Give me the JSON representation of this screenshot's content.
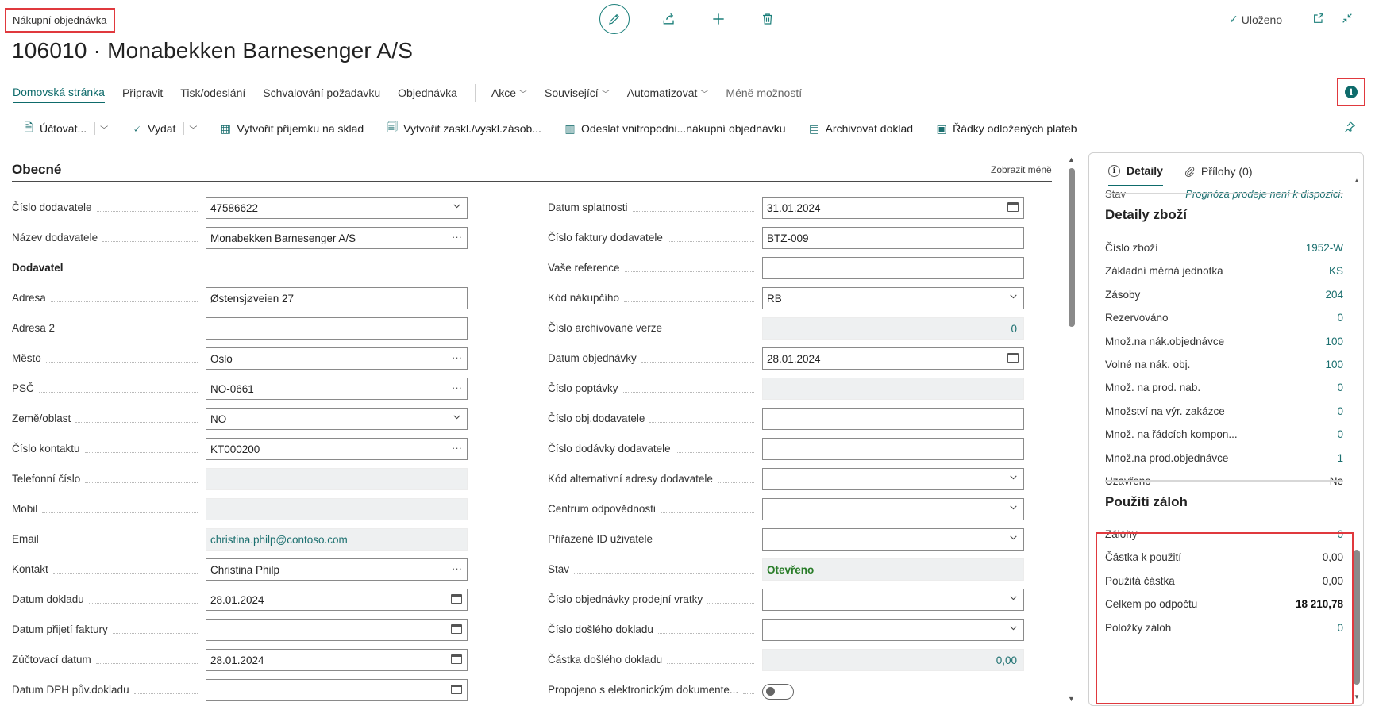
{
  "header": {
    "page_type": "Nákupní objednávka",
    "title": "106010 · Monabekken Barnesenger A/S",
    "saved_label": "Uloženo"
  },
  "nav": {
    "tabs": [
      {
        "label": "Domovská stránka"
      },
      {
        "label": "Připravit"
      },
      {
        "label": "Tisk/odeslání"
      },
      {
        "label": "Schvalování požadavku"
      },
      {
        "label": "Objednávka"
      }
    ],
    "menus": [
      {
        "label": "Akce"
      },
      {
        "label": "Související"
      },
      {
        "label": "Automatizovat"
      }
    ],
    "fewer_options": "Méně možností"
  },
  "actions": [
    {
      "label": "Účtovat...",
      "icon": "post-icon"
    },
    {
      "label": "Vydat",
      "icon": "release-icon"
    },
    {
      "label": "Vytvořit příjemku na sklad",
      "icon": "warehouse-receipt-icon"
    },
    {
      "label": "Vytvořit zaskl./vyskl.zásob...",
      "icon": "inventory-icon"
    },
    {
      "label": "Odeslat vnitropodni...nákupní objednávku",
      "icon": "intercompany-icon"
    },
    {
      "label": "Archivovat doklad",
      "icon": "archive-icon"
    },
    {
      "label": "Řádky odložených plateb",
      "icon": "deferral-icon"
    }
  ],
  "general": {
    "section_title": "Obecné",
    "show_less": "Zobrazit méně",
    "left": [
      {
        "label": "Číslo dodavatele",
        "value": "47586622",
        "kind": "dropdown"
      },
      {
        "label": "Název dodavatele",
        "value": "Monabekken Barnesenger A/S",
        "kind": "lookup"
      },
      {
        "label": "Dodavatel",
        "value": "",
        "kind": "heading"
      },
      {
        "label": "Adresa",
        "value": "Østensjøveien 27",
        "kind": "text"
      },
      {
        "label": "Adresa 2",
        "value": "",
        "kind": "text"
      },
      {
        "label": "Město",
        "value": "Oslo",
        "kind": "lookup"
      },
      {
        "label": "PSČ",
        "value": "NO-0661",
        "kind": "lookup"
      },
      {
        "label": "Země/oblast",
        "value": "NO",
        "kind": "dropdown"
      },
      {
        "label": "Číslo kontaktu",
        "value": "KT000200",
        "kind": "lookup"
      },
      {
        "label": "Telefonní číslo",
        "value": "",
        "kind": "readonly"
      },
      {
        "label": "Mobil",
        "value": "",
        "kind": "readonly"
      },
      {
        "label": "Email",
        "value": "christina.philp@contoso.com",
        "kind": "readonly-link"
      },
      {
        "label": "Kontakt",
        "value": "Christina Philp",
        "kind": "lookup"
      },
      {
        "label": "Datum dokladu",
        "value": "28.01.2024",
        "kind": "date"
      },
      {
        "label": "Datum přijetí faktury",
        "value": "",
        "kind": "date"
      },
      {
        "label": "Zúčtovací datum",
        "value": "28.01.2024",
        "kind": "date"
      },
      {
        "label": "Datum DPH pův.dokladu",
        "value": "",
        "kind": "date"
      }
    ],
    "right": [
      {
        "label": "Datum splatnosti",
        "value": "31.01.2024",
        "kind": "date"
      },
      {
        "label": "Číslo faktury dodavatele",
        "value": "BTZ-009",
        "kind": "text"
      },
      {
        "label": "Vaše reference",
        "value": "",
        "kind": "text"
      },
      {
        "label": "Kód nákupčího",
        "value": "RB",
        "kind": "dropdown"
      },
      {
        "label": "Číslo archivované verze",
        "value": "0",
        "kind": "readonly-num"
      },
      {
        "label": "Datum objednávky",
        "value": "28.01.2024",
        "kind": "date"
      },
      {
        "label": "Číslo poptávky",
        "value": "",
        "kind": "readonly"
      },
      {
        "label": "Číslo obj.dodavatele",
        "value": "",
        "kind": "text"
      },
      {
        "label": "Číslo dodávky dodavatele",
        "value": "",
        "kind": "text"
      },
      {
        "label": "Kód alternativní adresy dodavatele",
        "value": "",
        "kind": "dropdown"
      },
      {
        "label": "Centrum odpovědnosti",
        "value": "",
        "kind": "dropdown"
      },
      {
        "label": "Přiřazené ID uživatele",
        "value": "",
        "kind": "dropdown"
      },
      {
        "label": "Stav",
        "value": "Otevřeno",
        "kind": "status"
      },
      {
        "label": "Číslo objednávky prodejní vratky",
        "value": "",
        "kind": "dropdown"
      },
      {
        "label": "Číslo došlého dokladu",
        "value": "",
        "kind": "dropdown"
      },
      {
        "label": "Částka došlého dokladu",
        "value": "0,00",
        "kind": "readonly-num"
      },
      {
        "label": "Propojeno s elektronickým dokumente...",
        "value": "",
        "kind": "toggle"
      }
    ]
  },
  "factbox": {
    "tabs": [
      {
        "label": "Detaily"
      },
      {
        "label": "Přílohy (0)"
      }
    ],
    "cut_row": {
      "label": "Stav",
      "value": "Prognóza prodeje není k dispozici."
    },
    "item_details": {
      "title": "Detaily zboží",
      "rows": [
        {
          "label": "Číslo zboží",
          "value": "1952-W"
        },
        {
          "label": "Základní měrná jednotka",
          "value": "KS"
        },
        {
          "label": "Zásoby",
          "value": "204"
        },
        {
          "label": "Rezervováno",
          "value": "0"
        },
        {
          "label": "Množ.na nák.objednávce",
          "value": "100"
        },
        {
          "label": "Volné na nák. obj.",
          "value": "100"
        },
        {
          "label": "Množ. na prod. nab.",
          "value": "0"
        },
        {
          "label": "Množství na výr. zakázce",
          "value": "0"
        },
        {
          "label": "Množ. na řádcích kompon...",
          "value": "0"
        },
        {
          "label": "Množ.na prod.objednávce",
          "value": "1"
        },
        {
          "label": "Uzavřeno",
          "value": "Ne"
        }
      ]
    },
    "advances": {
      "title": "Použití záloh",
      "rows": [
        {
          "label": "Zálohy",
          "value": "0"
        },
        {
          "label": "Částka k použití",
          "value": "0,00"
        },
        {
          "label": "Použitá částka",
          "value": "0,00"
        },
        {
          "label": "Celkem po odpočtu",
          "value": "18 210,78"
        },
        {
          "label": "Položky záloh",
          "value": "0"
        }
      ]
    }
  }
}
